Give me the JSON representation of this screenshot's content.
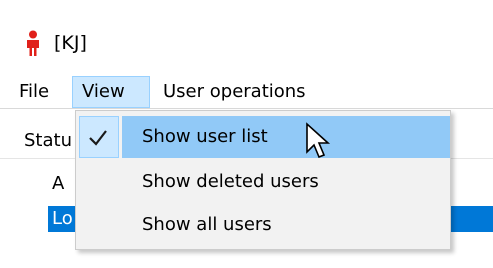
{
  "window": {
    "title": "[KJ]"
  },
  "menubar": {
    "items": [
      {
        "label": "File"
      },
      {
        "label": "View"
      },
      {
        "label": "User operations"
      }
    ]
  },
  "list": {
    "header": "Statu",
    "rows": [
      {
        "text": "A"
      },
      {
        "text": "Lo"
      }
    ]
  },
  "view_menu": {
    "items": [
      {
        "label": "Show user list",
        "checked": true
      },
      {
        "label": "Show deleted users",
        "checked": false
      },
      {
        "label": "Show all users",
        "checked": false
      }
    ]
  },
  "colors": {
    "accent": "#0078d7",
    "menu_open_bg": "#cce8ff",
    "menu_hover_bg": "#91c9f7",
    "icon_red": "#e0201a"
  }
}
